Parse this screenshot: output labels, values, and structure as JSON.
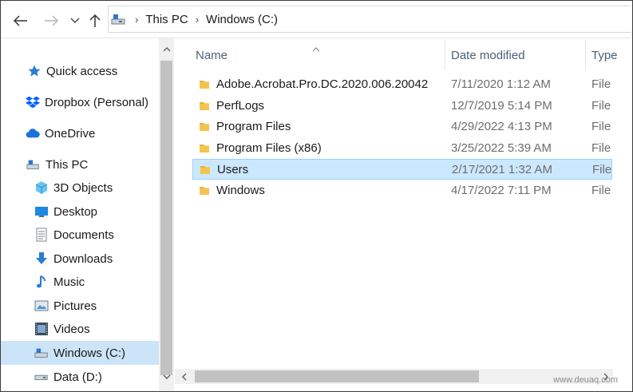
{
  "navigation": {
    "breadcrumb": [
      "This PC",
      "Windows (C:)"
    ]
  },
  "sidebar": {
    "items": [
      {
        "label": "Quick access",
        "icon": "star-icon"
      },
      {
        "label": "Dropbox (Personal)",
        "icon": "dropbox-icon"
      },
      {
        "label": "OneDrive",
        "icon": "onedrive-icon"
      },
      {
        "label": "This PC",
        "icon": "computer-icon"
      },
      {
        "label": "3D Objects",
        "icon": "cube-icon"
      },
      {
        "label": "Desktop",
        "icon": "desktop-icon"
      },
      {
        "label": "Documents",
        "icon": "document-icon"
      },
      {
        "label": "Downloads",
        "icon": "download-icon"
      },
      {
        "label": "Music",
        "icon": "music-icon"
      },
      {
        "label": "Pictures",
        "icon": "pictures-icon"
      },
      {
        "label": "Videos",
        "icon": "video-icon"
      },
      {
        "label": "Windows (C:)",
        "icon": "drive-icon",
        "selected": true
      },
      {
        "label": "Data (D:)",
        "icon": "drive-icon"
      }
    ]
  },
  "columns": {
    "name": "Name",
    "date": "Date modified",
    "type": "Type"
  },
  "files": [
    {
      "name": "Adobe.Acrobat.Pro.DC.2020.006.20042",
      "date": "7/11/2020 1:12 AM",
      "type": "File"
    },
    {
      "name": "PerfLogs",
      "date": "12/7/2019 5:14 PM",
      "type": "File"
    },
    {
      "name": "Program Files",
      "date": "4/29/2022 4:13 PM",
      "type": "File"
    },
    {
      "name": "Program Files (x86)",
      "date": "3/25/2022 5:39 AM",
      "type": "File"
    },
    {
      "name": "Users",
      "date": "2/17/2021 1:32 AM",
      "type": "File",
      "selected": true
    },
    {
      "name": "Windows",
      "date": "4/17/2022 7:11 PM",
      "type": "File"
    }
  ],
  "watermark": "www.deuaq.com",
  "colors": {
    "selection": "#cce8ff",
    "selection_border": "#99d1ff",
    "sidebar_selection": "#cce4f7",
    "folder": "#f3c54e"
  }
}
